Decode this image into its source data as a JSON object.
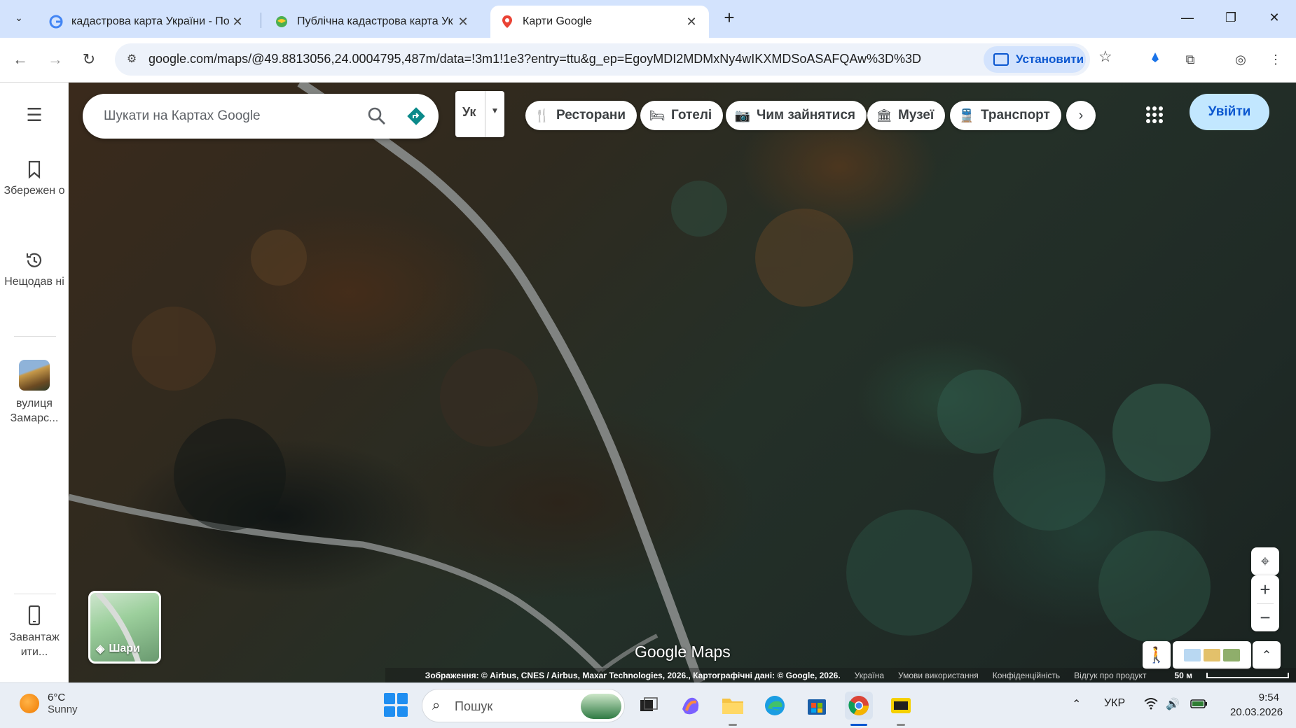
{
  "browser": {
    "tabs": [
      {
        "title": "кадастрова карта України - По",
        "active": false
      },
      {
        "title": "Публічна кадастрова карта Ук",
        "active": false
      },
      {
        "title": "Карти Google",
        "active": true
      }
    ],
    "url": "google.com/maps/@49.8813056,24.0004795,487m/data=!3m1!1e3?entry=ttu&g_ep=EgoyMDI2MDMxNy4wIKXMDSoASAFQAw%3D%3D",
    "install_label": "Установити"
  },
  "sidebar": {
    "items": [
      {
        "label": "Збережен о",
        "icon": "bookmark-icon"
      },
      {
        "label": "Нещодав ні",
        "icon": "history-icon"
      },
      {
        "label": "вулиця Замарс...",
        "icon": "place-thumbnail"
      },
      {
        "label": "Завантаж ити...",
        "icon": "phone-icon"
      }
    ]
  },
  "search": {
    "placeholder": "Шукати на Картах Google",
    "lang_code": "Ук"
  },
  "chips": [
    {
      "label": "Ресторани",
      "icon": "restaurant-icon"
    },
    {
      "label": "Готелі",
      "icon": "hotel-icon"
    },
    {
      "label": "Чим зайнятися",
      "icon": "camera-icon"
    },
    {
      "label": "Музеї",
      "icon": "museum-icon"
    },
    {
      "label": "Транспорт",
      "icon": "transit-icon"
    }
  ],
  "signin_label": "Увійти",
  "layers_label": "Шари",
  "logo": "Google Maps",
  "attribution": {
    "copyright": "Зображення: © Airbus, CNES / Airbus, Maxar Technologies, 2026., Картографічні дані: © Google, 2026.",
    "country": "Україна",
    "terms": "Умови використання",
    "privacy": "Конфіденційність",
    "feedback": "Відгук про продукт",
    "scale": "50 м"
  },
  "taskbar": {
    "weather_temp": "6°C",
    "weather_desc": "Sunny",
    "search_text": "Пошук",
    "lang": "УКР",
    "time": "9:54",
    "date": "20.03.2026"
  },
  "colors": {
    "accent": "#0b57d0",
    "signin_bg": "#c2e7ff",
    "tabstrip_bg": "#d3e3fd"
  }
}
